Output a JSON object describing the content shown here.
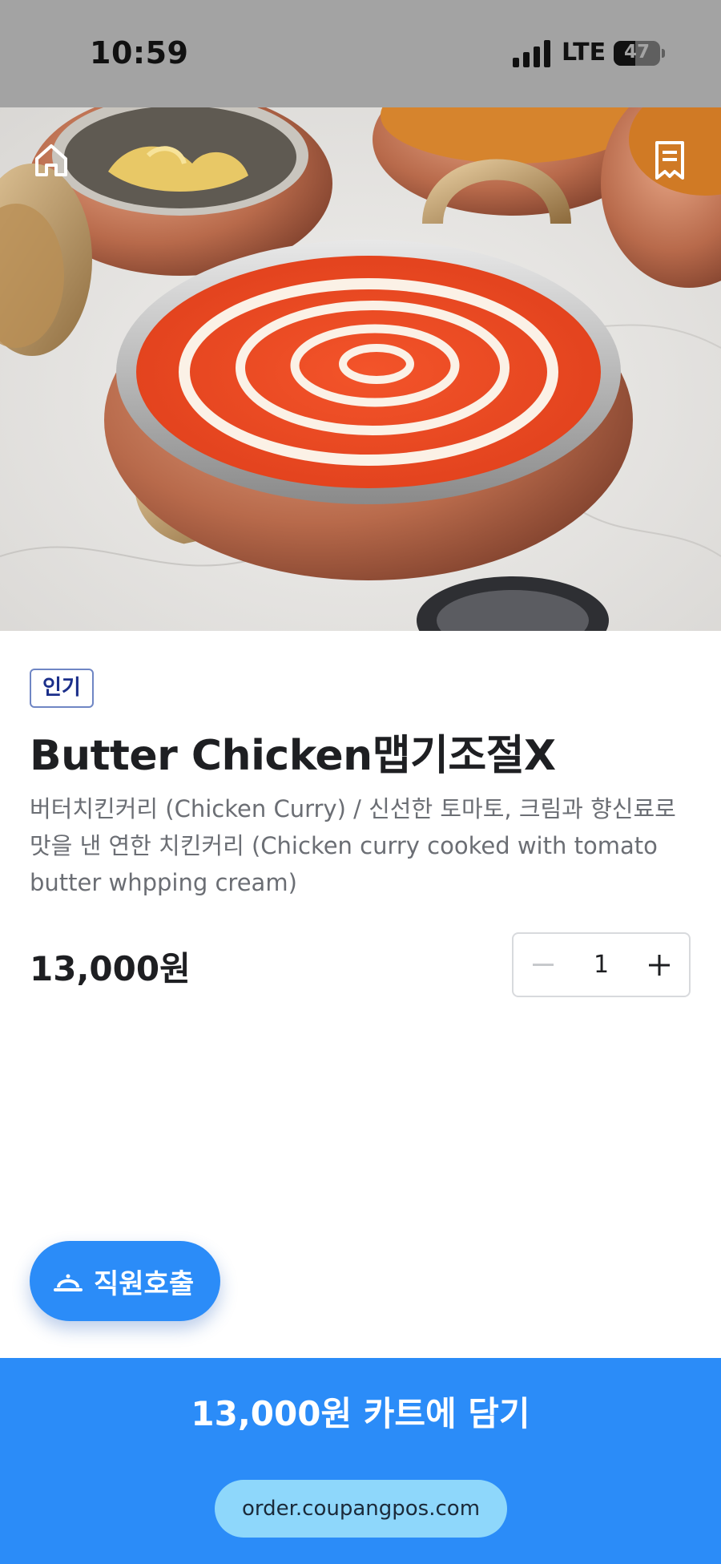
{
  "status_bar": {
    "time": "10:59",
    "network": "LTE",
    "battery": "47",
    "battery_level": 0.47
  },
  "hero": {
    "home_icon": "home-icon",
    "receipt_icon": "receipt-icon"
  },
  "product": {
    "badge": "인기",
    "name": "Butter Chicken맵기조절X",
    "description": "버터치킨커리 (Chicken Curry) / 신선한 토마토, 크림과 향신료로 맛을 낸 연한 치킨커리 (Chicken curry cooked with tomato butter whpping cream)",
    "price": "13,000원",
    "quantity": "1"
  },
  "staff_call": {
    "label": "직원호출",
    "icon": "bell-icon"
  },
  "cart": {
    "label": "13,000원 카트에 담기"
  },
  "url": "order.coupangpos.com",
  "colors": {
    "accent": "#2b8cf8",
    "badge_text": "#1b2f8a",
    "url_pill": "#8ed7fb",
    "status_bar": "#a3a3a3"
  }
}
